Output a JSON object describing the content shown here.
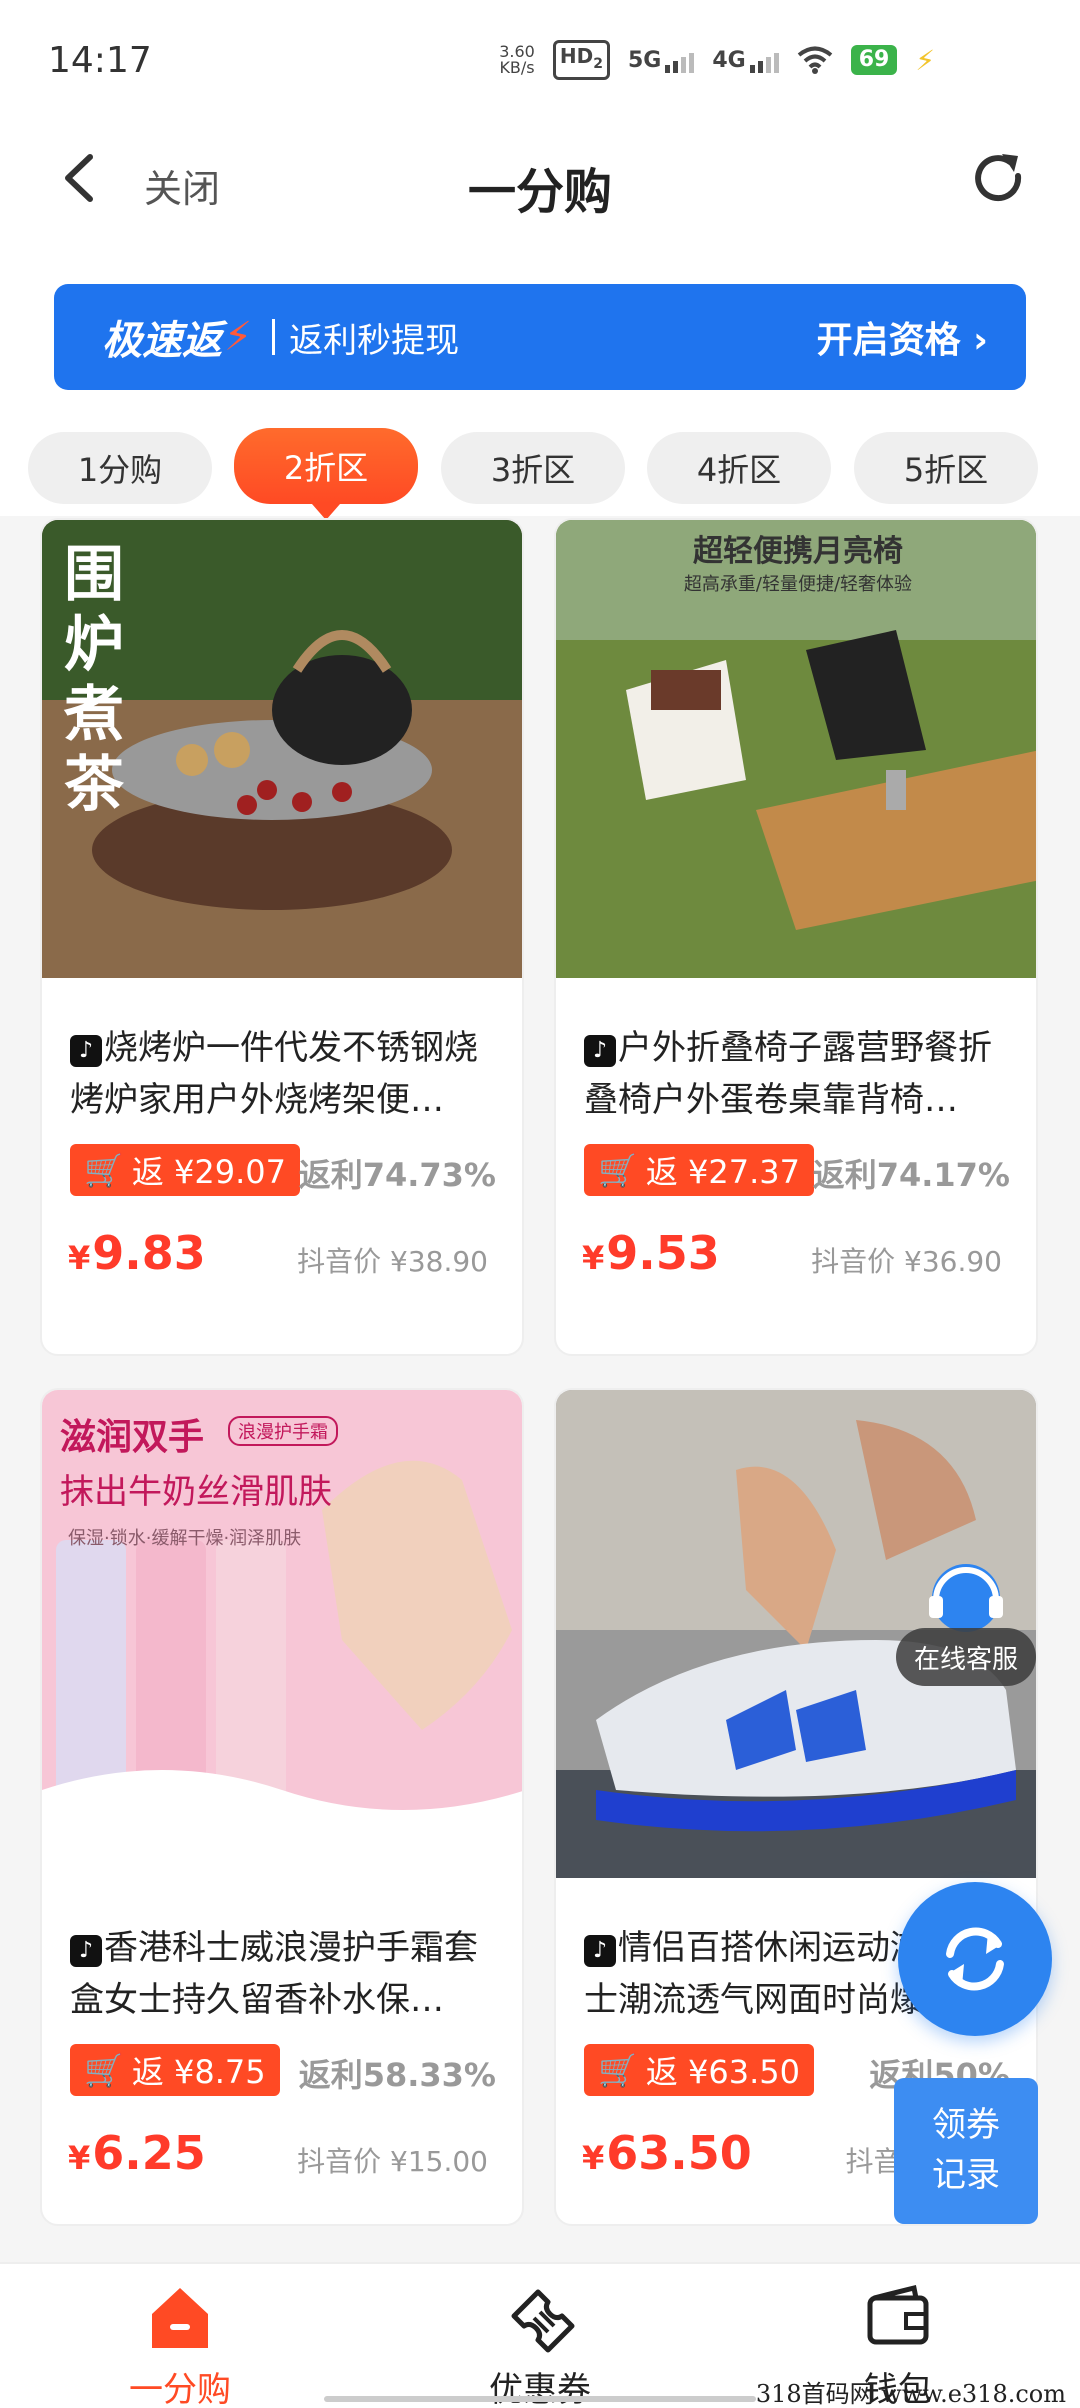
{
  "status_bar": {
    "time": "14:17",
    "speed_value": "3.60",
    "speed_unit": "KB/s",
    "hd": "HD",
    "hd_sub": "2",
    "sig1": "5G",
    "sig2": "4G",
    "battery": "69"
  },
  "header": {
    "close_label": "关闭",
    "title": "一分购"
  },
  "banner": {
    "brand": "极速返",
    "subtitle": "返利秒提现",
    "cta": "开启资格",
    "accent": "#1f74ee"
  },
  "tabs": [
    {
      "label": "1分购",
      "active": false
    },
    {
      "label": "2折区",
      "active": true
    },
    {
      "label": "3折区",
      "active": false
    },
    {
      "label": "4折区",
      "active": false
    },
    {
      "label": "5折区",
      "active": false
    }
  ],
  "products": [
    {
      "image_text_main": "围炉煮茶",
      "title": "烧烤炉一件代发不锈钢烧烤炉家用户外烧烤架便…",
      "rebate": "返 ¥29.07",
      "rebate_rate": "返利74.73%",
      "price_symbol": "¥",
      "price": "9.83",
      "orig_price": "抖音价 ¥38.90"
    },
    {
      "image_text_main": "超轻便携月亮椅",
      "image_text_sub": "超高承重/轻量便捷/轻奢体验",
      "title": "户外折叠椅子露营野餐折叠椅户外蛋卷桌靠背椅…",
      "rebate": "返 ¥27.37",
      "rebate_rate": "返利74.17%",
      "price_symbol": "¥",
      "price": "9.53",
      "orig_price": "抖音价 ¥36.90"
    },
    {
      "image_text_main": "滋润双手",
      "image_tag": "浪漫护手霜",
      "image_text_sub": "抹出牛奶丝滑肌肤",
      "image_text_small": "保湿·锁水·缓解干燥·润泽肌肤",
      "title": "香港科士威浪漫护手霜套盒女士持久留香补水保…",
      "rebate": "返 ¥8.75",
      "rebate_rate": "返利58.33%",
      "price_symbol": "¥",
      "price": "6.25",
      "orig_price": "抖音价 ¥15.00"
    },
    {
      "title": "情侣百搭休闲运动潮鞋男士潮流透气网面时尚爆…",
      "rebate": "返 ¥63.50",
      "rebate_rate": "返利50%",
      "price_symbol": "¥",
      "price": "63.50",
      "orig_price": "抖音价 ¥1…"
    }
  ],
  "floating": {
    "customer_service": "在线客服",
    "coupon_record_line1": "领券",
    "coupon_record_line2": "记录"
  },
  "bottom_nav": [
    {
      "label": "一分购",
      "active": true,
      "icon": "home-icon"
    },
    {
      "label": "优惠券",
      "active": false,
      "icon": "ticket-icon"
    },
    {
      "label": "钱包",
      "active": false,
      "icon": "wallet-icon"
    }
  ],
  "watermark": "318首码网 www.e318.com",
  "colors": {
    "accent_orange": "#ff4a24",
    "price_red": "#ff3b2a",
    "brand_blue": "#1f74ee"
  }
}
